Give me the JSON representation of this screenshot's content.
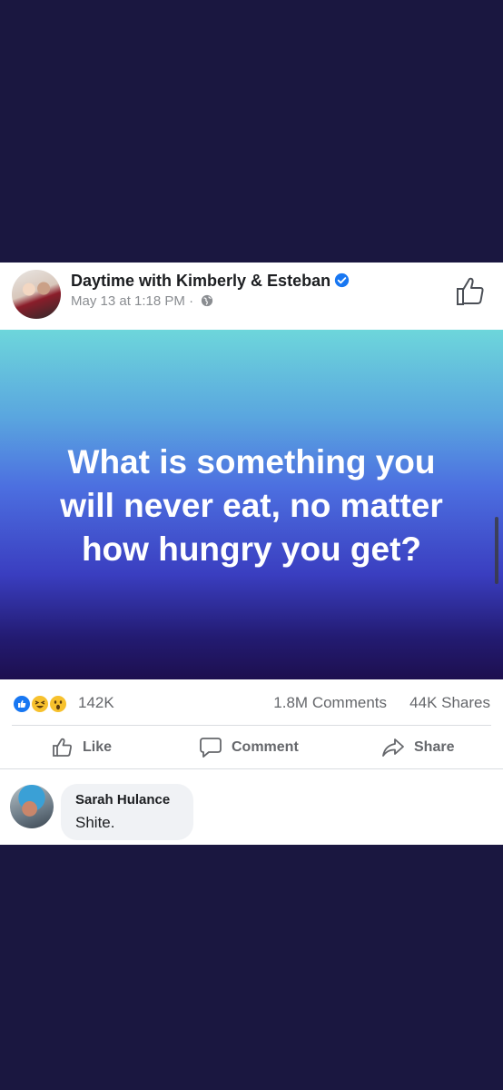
{
  "post": {
    "page_name": "Daytime with Kimberly & Esteban",
    "timestamp": "May 13 at 1:18 PM",
    "separator": " · ",
    "verified": true,
    "banner_text": "What is something you\nwill never eat, no matter\nhow hungry you get?",
    "banner_gradient": [
      "#6dd6db",
      "#4c6fe0",
      "#1d0f4e"
    ]
  },
  "stats": {
    "reactions": [
      "like",
      "haha",
      "wow"
    ],
    "reaction_count": "142K",
    "comments": "1.8M Comments",
    "shares": "44K Shares"
  },
  "actions": {
    "like": "Like",
    "comment": "Comment",
    "share": "Share"
  },
  "comment": {
    "author": "Sarah Hulance",
    "text": "Shite."
  },
  "colors": {
    "background": "#1a1740",
    "facebook_blue": "#1877f2",
    "action_gray": "#65676b"
  }
}
